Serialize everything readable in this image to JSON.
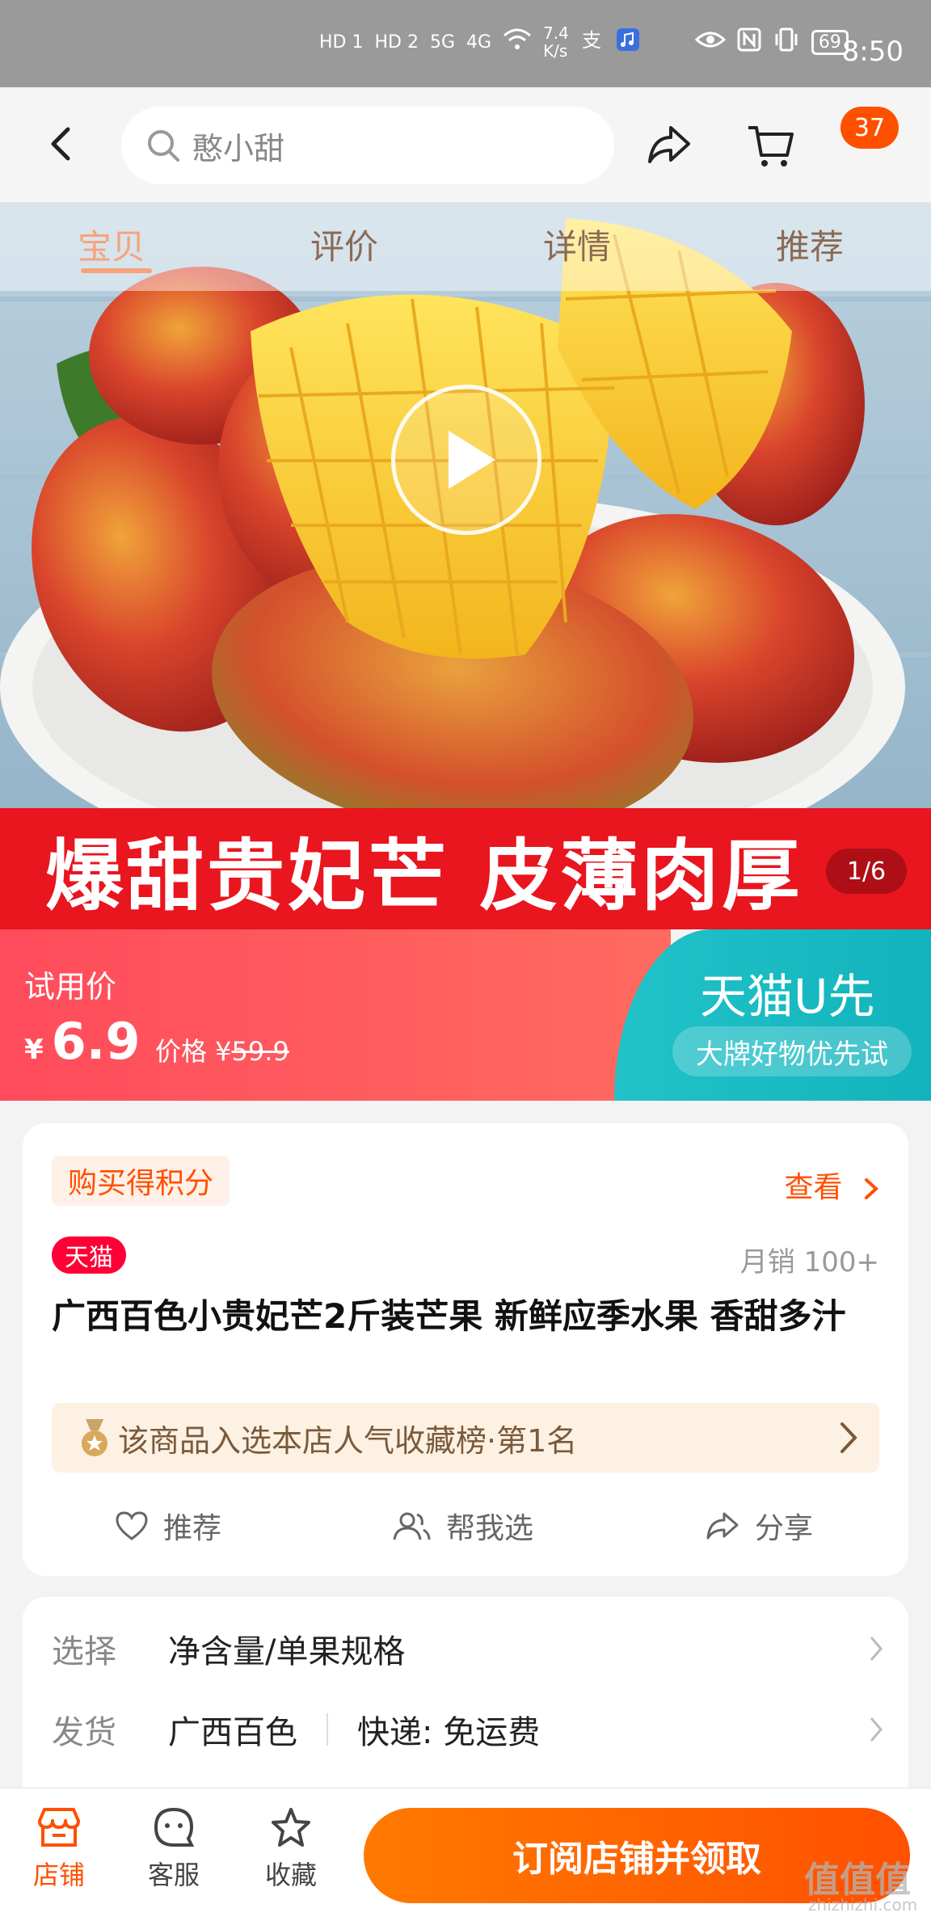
{
  "status_bar": {
    "network_speed": "7.4\nK/s",
    "battery": "69",
    "time": "8:50",
    "sim1": "HD 1",
    "sim2": "HD 2",
    "net1": "5G",
    "net2": "4G"
  },
  "search": {
    "placeholder": "憨小甜"
  },
  "cart": {
    "badge_count": "37"
  },
  "tabs": [
    "宝贝",
    "评价",
    "详情",
    "推荐"
  ],
  "hero": {
    "banner_text": "爆甜贵妃芒 皮薄肉厚",
    "page_indicator": "1/6"
  },
  "promo": {
    "label": "试用价",
    "currency": "¥",
    "price": "6.9",
    "orig_label": "价格 ¥",
    "orig_price": "59.9",
    "brand": "天猫U先",
    "tagline": "大牌好物优先试"
  },
  "product": {
    "points_tag": "购买得积分",
    "view_link": "查看",
    "store_badge": "天猫",
    "monthly_sales": "月销 100+",
    "title": "广西百色小贵妃芒2斤装芒果 新鲜应季水果 香甜多汁",
    "rank_text": "该商品入选本店人气收藏榜·第1名",
    "actions": {
      "recommend": "推荐",
      "help_choose": "帮我选",
      "share": "分享"
    }
  },
  "options": {
    "select_key": "选择",
    "select_value": "净含量/单果规格",
    "ship_key": "发货",
    "ship_origin": "广西百色",
    "ship_method": "快递: 免运费"
  },
  "bottom_bar": {
    "store": "店铺",
    "service": "客服",
    "favorite": "收藏",
    "subscribe_button": "订阅店铺并领取"
  },
  "watermark": {
    "main": "值值值",
    "sub": "zhizhizhi.com"
  },
  "colors": {
    "accent": "#ff5000",
    "tmall_red": "#ff0036",
    "promo_red": "#ff4b5c",
    "promo_teal": "#13b3bd"
  }
}
